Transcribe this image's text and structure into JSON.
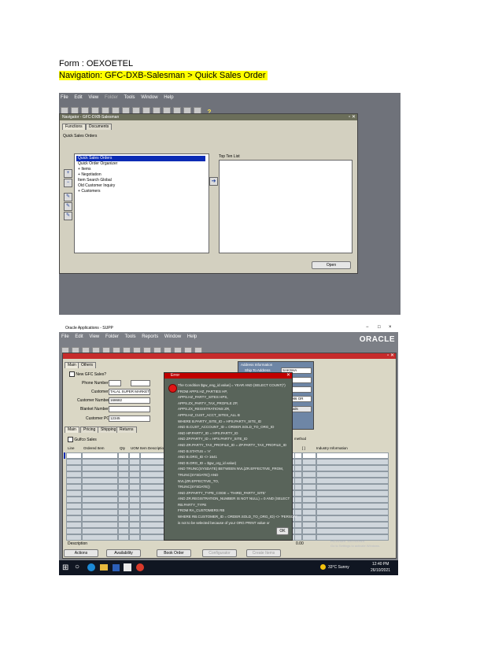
{
  "doc": {
    "form_line": "Form : OEXOETEL",
    "nav_line": "Navigation: GFC-DXB-Salesman > Quick Sales Order"
  },
  "shot1": {
    "menu": [
      "File",
      "Edit",
      "View",
      "Folder",
      "Tools",
      "Window",
      "Help"
    ],
    "navigator_title": "Navigator - GFC-DXB-Salesman",
    "tab_functions": "Functions",
    "tab_documents": "Documents",
    "section_title": "Quick Sales Orders",
    "list_items": [
      {
        "text": "Quick Sales Orders",
        "selected": true,
        "prefix": ""
      },
      {
        "text": "Quick Order Organizer",
        "selected": false,
        "prefix": ""
      },
      {
        "text": "Items",
        "selected": false,
        "prefix": "+ "
      },
      {
        "text": "Negotiation",
        "selected": false,
        "prefix": "+ "
      },
      {
        "text": "Item Search Global",
        "selected": false,
        "prefix": ""
      },
      {
        "text": "Old Customer Inquiry",
        "selected": false,
        "prefix": ""
      },
      {
        "text": "Customers",
        "selected": false,
        "prefix": "+ "
      }
    ],
    "top_ten_label": "Top Ten List",
    "open_button": "Open",
    "side_icons": [
      "+",
      "−",
      "✎",
      "✎",
      "✎"
    ],
    "help_glyph": "?"
  },
  "shot2": {
    "window_title": "Oracle Applications - SUPP",
    "window_controls": [
      "−",
      "□",
      "×"
    ],
    "menu": [
      "File",
      "Edit",
      "View",
      "Folder",
      "Tools",
      "Reports",
      "Window",
      "Help"
    ],
    "brand": "ORACLE",
    "top_tabs": [
      "Main",
      "Others"
    ],
    "new_gfc_sales": "New GFC Sales?",
    "labels": {
      "phone": "Phone Number",
      "customer": "Customer",
      "customer_number": "Customer Number",
      "blanket": "Blanket Number",
      "customer_po": "Customer PO"
    },
    "values": {
      "customer": "TALAL SUPER MARKET",
      "customer_number": "168682",
      "customer_po": "12345"
    },
    "address_info": "Address Information",
    "ship_to_label": "Ship To Address",
    "ship_to_value": "SAKSHA",
    "right_values": [
      "AE",
      "",
      "13086 OR",
      "Details"
    ],
    "lower_tabs": [
      "Main",
      "Pricing",
      "Shipping",
      "Returns"
    ],
    "gulfco_sales": "Gulfco Sales",
    "columns": [
      "Line",
      "Ordered Item",
      "Qty",
      "UOM",
      "Item Description"
    ],
    "right_columns": [
      "method",
      "[ ]",
      "Industry Information"
    ],
    "description_label": "Description",
    "bottom_buttons": [
      "Actions",
      "Availability",
      "Book Order",
      "Configurator",
      "Create Items"
    ],
    "watermark": [
      "Activate Windows",
      "Go to Settings to activate Windows."
    ],
    "time_field": "0.00",
    "error": {
      "title": "Error",
      "lines": [
        "The Condition $gw_eng_id.value] = YEAR AND (SELECT COUNT(*)",
        "FROM   APPS.HZ_PARTIES              HP,",
        "       APPS.HZ_PARTY_SITES          HPS,",
        "       APPS.ZX_PARTY_TAX_PROFILE    ZP,",
        "       APPS.ZX_REGISTRATIONS        ZR,",
        "       APPS.HZ_CUST_ACCT_SITES_ALL  B",
        "WHERE  B.PARTY_SITE_ID = HPS.PARTY_SITE_ID",
        "AND    B.CUST_ACCOUNT_ID = ORDER.SOLD_TO_ORG_ID",
        "AND    HP.PARTY_ID = HPS.PARTY_ID",
        "AND    ZP.PARTY_ID = HPS.PARTY_SITE_ID",
        "AND    ZR.PARTY_TAX_PROFILE_ID = ZP.PARTY_TAX_PROFILE_ID",
        "AND    B.STATUS = 'A'",
        "AND    B.ORG_ID <> 1641",
        "AND    B.ORG_ID = $gw_org_id.value)",
        "AND    TRUNC(SYSDATE) BETWEEN NVL(ZR.EFFECTIVE_FROM,",
        "                 TRUNC(SYSDATE)) AND",
        "       NVL(ZR.EFFECTIVE_TO,",
        "           TRUNC(SYSDATE))",
        "AND    ZP.PARTY_TYPE_CODE = 'THIRD_PARTY_SITE'",
        "AND    ZR.REGISTRATION_NUMBER IS NOT NULL) = 0 AND (SELECT",
        "RB.PARTY_TYPE",
        "FROM   RA_CUSTOMERS RB",
        "WHERE  RB.CUSTOMER_ID = ORDER.SOLD_TO_ORG_ID) <> 'PERSON'",
        "is not to be selected because of your ORG PRINT value or"
      ],
      "ok": "OK"
    },
    "taskbar": {
      "weather": "33°C  Sunny",
      "time": "12:40 PM",
      "date": "26/10/2021",
      "search_glyph": "○"
    }
  },
  "colors": {
    "highlight": "#ffff00",
    "oracle_bg": "#6f727a",
    "navigator_panel": "#d3d0c0",
    "error_bg": "#59645a",
    "error_title": "#c00000",
    "selection": "#0a2bb5"
  }
}
